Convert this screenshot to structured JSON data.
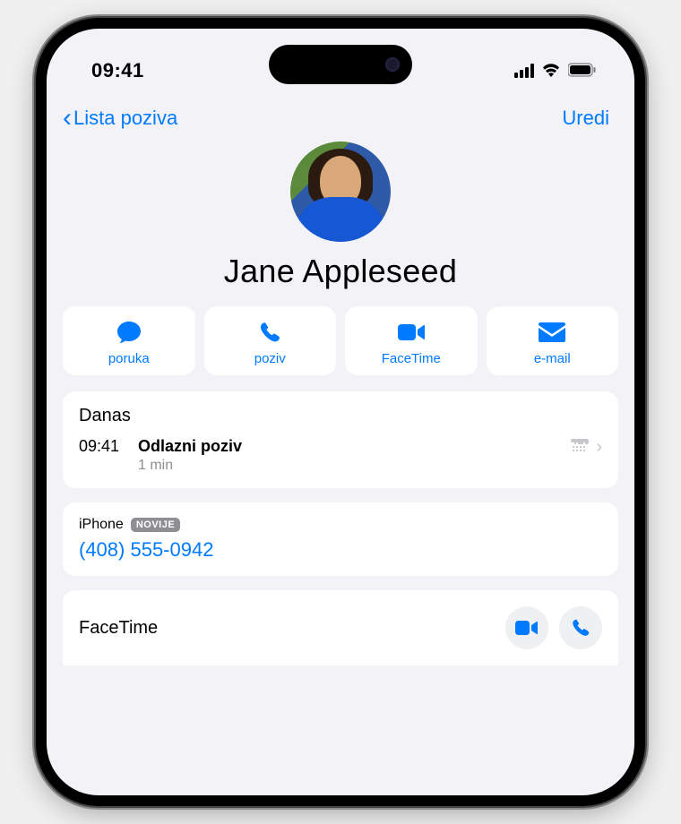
{
  "status": {
    "time": "09:41"
  },
  "nav": {
    "back_label": "Lista poziva",
    "edit_label": "Uredi"
  },
  "contact": {
    "name": "Jane Appleseed"
  },
  "actions": {
    "message": "poruka",
    "call": "poziv",
    "facetime": "FaceTime",
    "email": "e-mail"
  },
  "history": {
    "header": "Danas",
    "entries": [
      {
        "time": "09:41",
        "type": "Odlazni poziv",
        "duration": "1 min"
      }
    ]
  },
  "phone": {
    "label": "iPhone",
    "badge": "NOVIJE",
    "number": "(408) 555-0942"
  },
  "facetime": {
    "label": "FaceTime"
  }
}
